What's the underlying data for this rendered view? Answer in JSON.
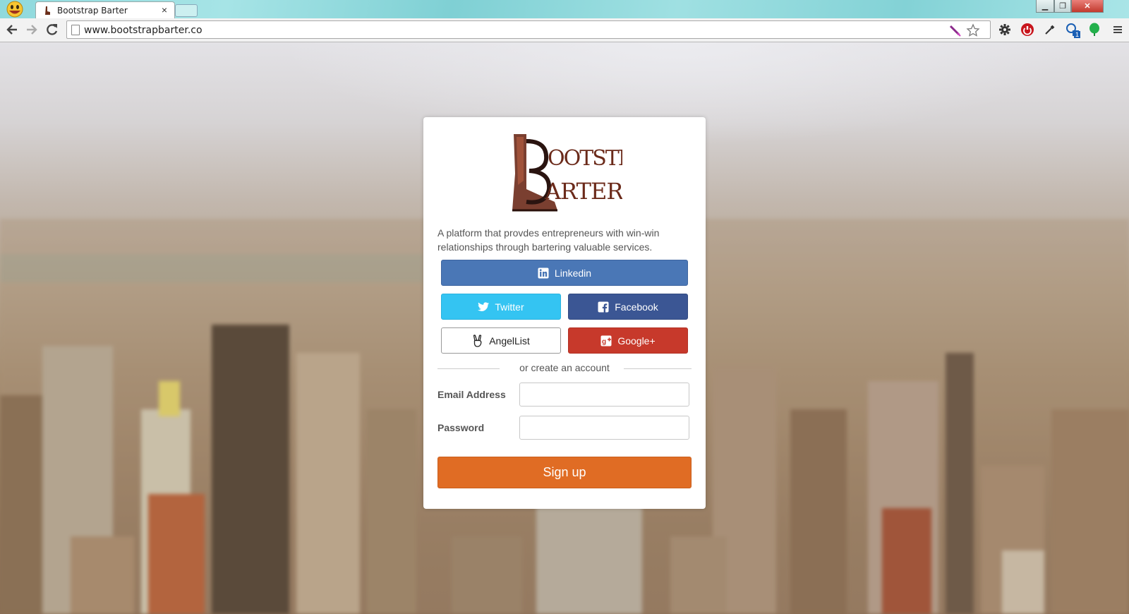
{
  "browser": {
    "tab_title": "Bootstrap Barter",
    "tab_close": "×",
    "url": "www.bootstrapbarter.co",
    "extension_badge": "1"
  },
  "card": {
    "logo_text": [
      "OOTSTRAP",
      "ARTER"
    ],
    "tagline": "A platform that provdes entrepreneurs with win-win relationships through bartering valuable services.",
    "social": {
      "linkedin": "Linkedin",
      "twitter": "Twitter",
      "facebook": "Facebook",
      "angellist": "AngelList",
      "google": "Google+"
    },
    "divider_text": "or create an account",
    "form": {
      "email_label": "Email Address",
      "email_value": "",
      "password_label": "Password",
      "password_value": ""
    },
    "signup_label": "Sign up"
  },
  "colors": {
    "linkedin": "#4a77b6",
    "twitter": "#34c4f2",
    "facebook": "#3b5694",
    "google": "#c7392b",
    "signup": "#e06c24"
  }
}
